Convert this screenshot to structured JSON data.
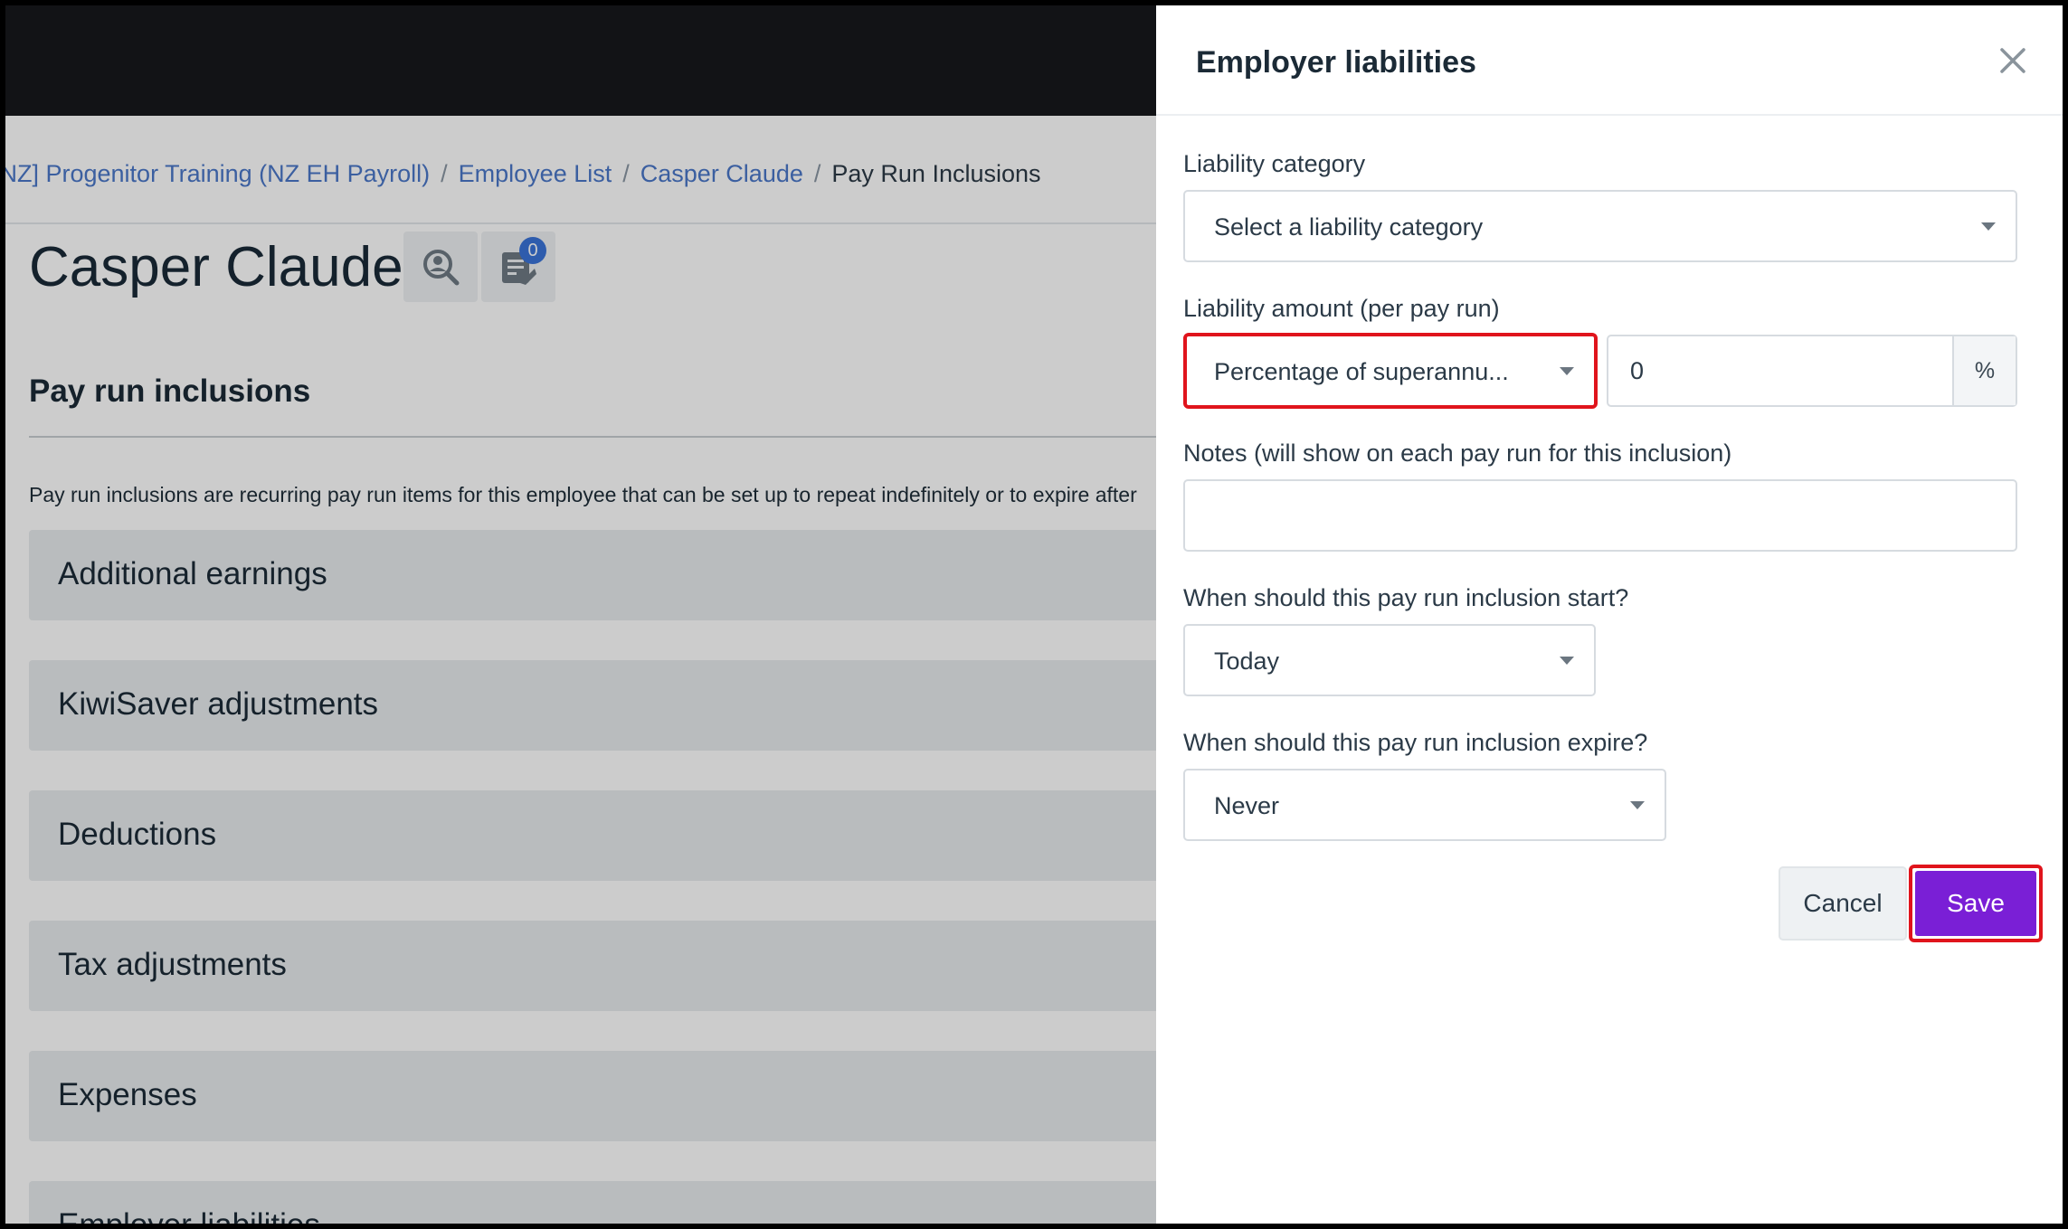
{
  "breadcrumb": {
    "items": [
      "[NZ] Progenitor Training (NZ EH Payroll)",
      "Employee List",
      "Casper Claude"
    ],
    "current": "Pay Run Inclusions"
  },
  "employee": {
    "name": "Casper Claude",
    "notes_count": "0"
  },
  "section": {
    "title": "Pay run inclusions",
    "description": "Pay run inclusions are recurring pay run items for this employee that can be set up to repeat indefinitely or to expire after"
  },
  "accordions": [
    "Additional earnings",
    "KiwiSaver adjustments",
    "Deductions",
    "Tax adjustments",
    "Expenses",
    "Employer liabilities"
  ],
  "drawer": {
    "title": "Employer liabilities",
    "liability_category": {
      "label": "Liability category",
      "value": "Select a liability category"
    },
    "liability_amount": {
      "label": "Liability amount (per pay run)",
      "type_value": "Percentage of superannu...",
      "amount_value": "0",
      "addon": "%"
    },
    "notes": {
      "label": "Notes (will show on each pay run for this inclusion)",
      "value": ""
    },
    "start": {
      "label": "When should this pay run inclusion start?",
      "value": "Today"
    },
    "expire": {
      "label": "When should this pay run inclusion expire?",
      "value": "Never"
    },
    "cancel_label": "Cancel",
    "save_label": "Save"
  },
  "colors": {
    "save_button": "#7a1fd6",
    "highlight": "#e0141c",
    "link": "#4a77c9",
    "badge": "#3a73d9"
  },
  "icons": [
    "search-icon",
    "notes-icon",
    "close-icon",
    "chevron-down-icon"
  ]
}
